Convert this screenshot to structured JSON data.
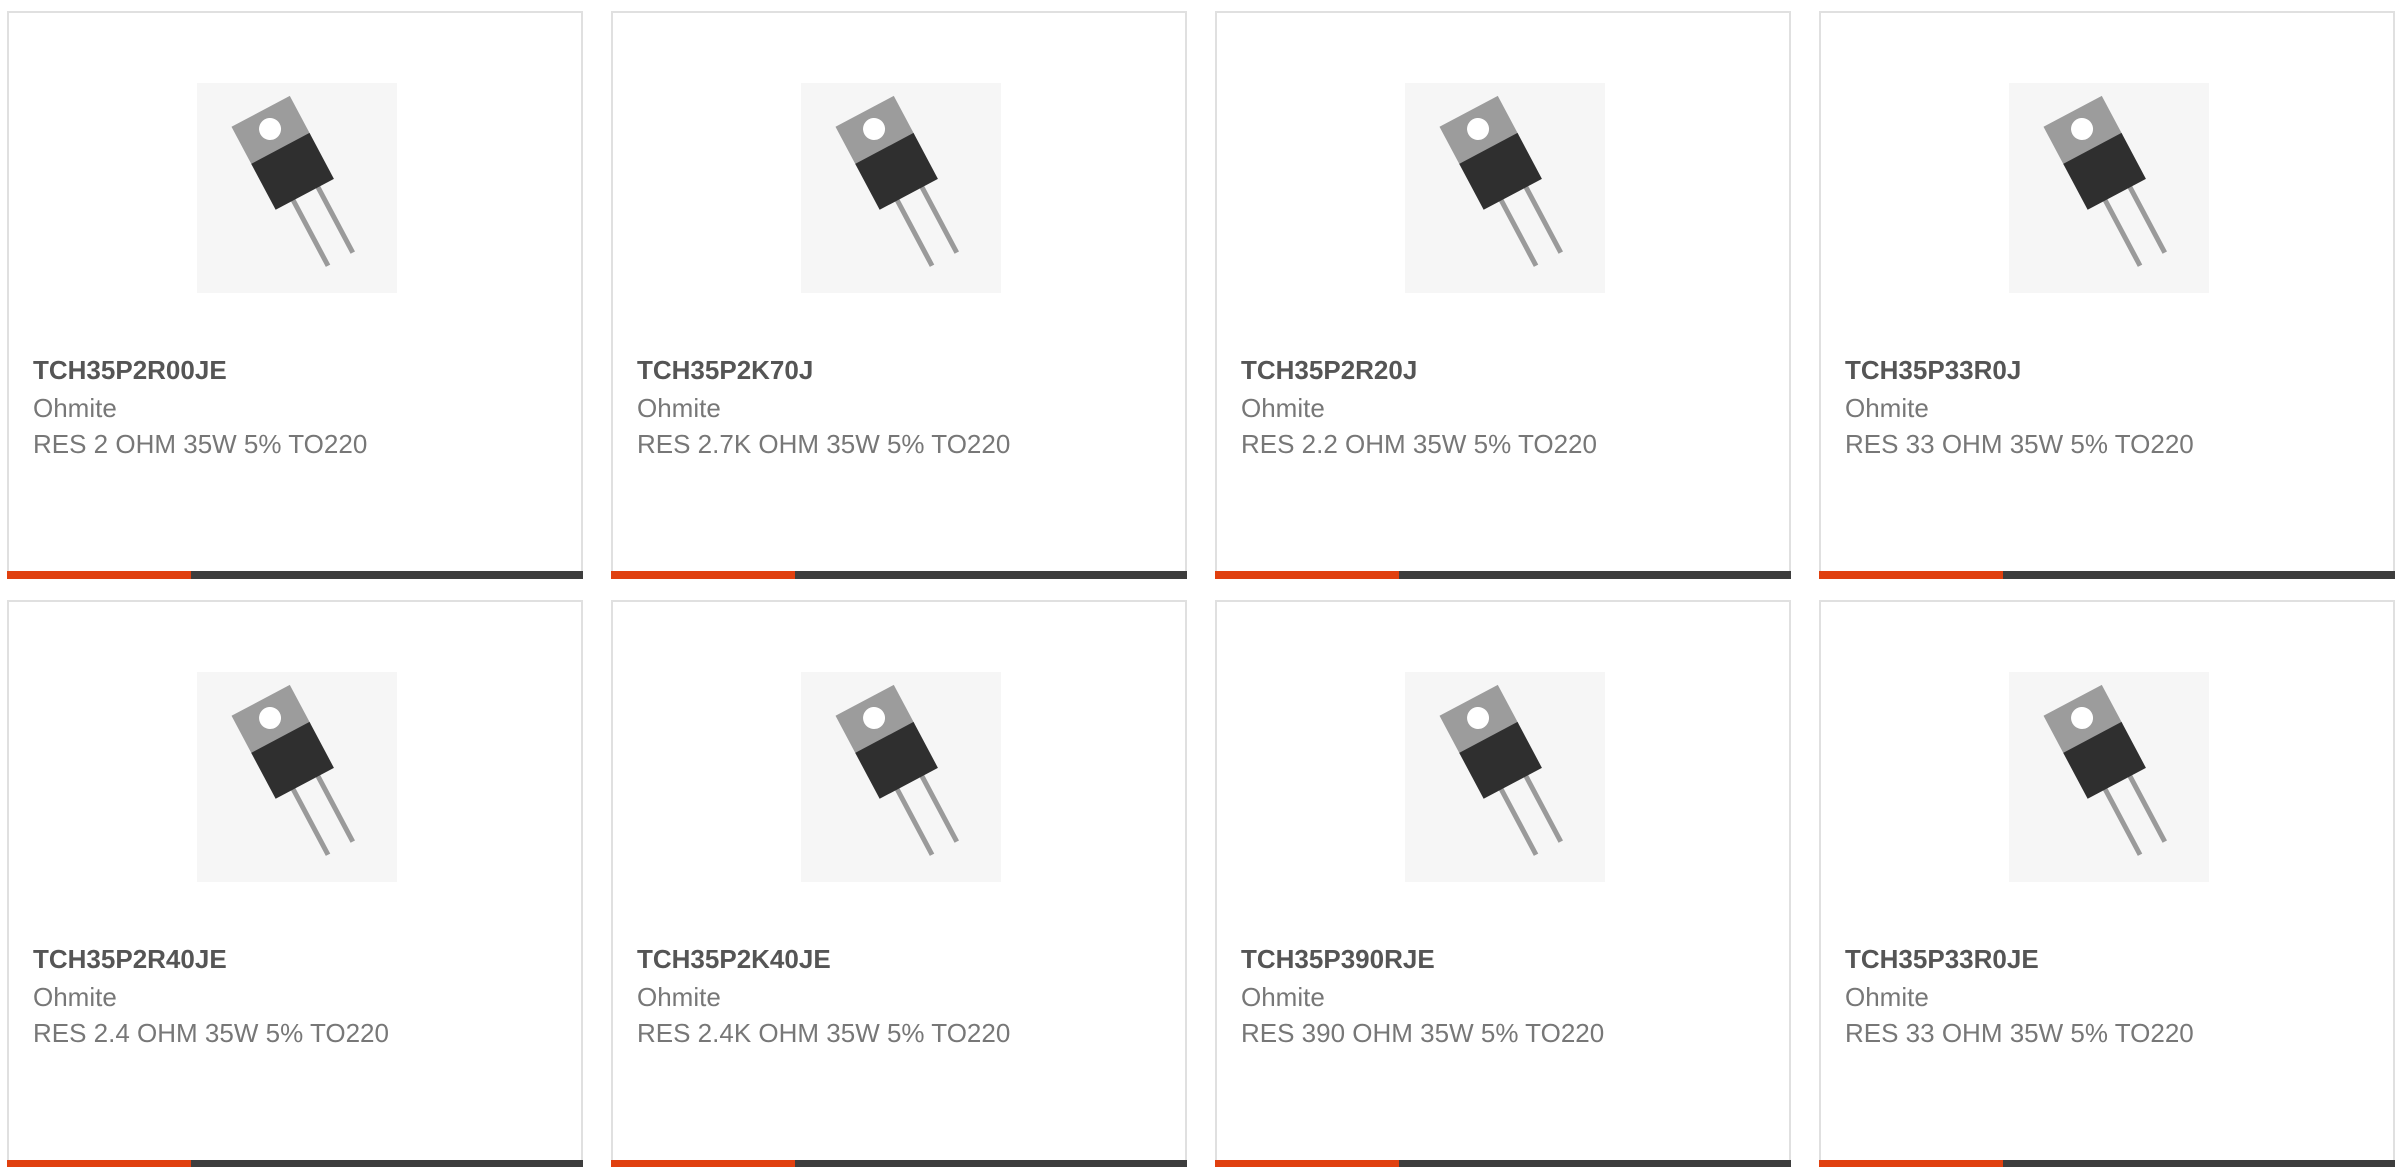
{
  "colors": {
    "accent": "#e0400f",
    "bar": "#3d3d3d",
    "border": "#e0e0e0",
    "part_text": "#555555",
    "meta_text": "#777777"
  },
  "products": [
    {
      "part": "TCH35P2R00JE",
      "manufacturer": "Ohmite",
      "description": "RES 2 OHM 35W 5% TO220",
      "icon": "to220-resistor-image"
    },
    {
      "part": "TCH35P2K70J",
      "manufacturer": "Ohmite",
      "description": "RES 2.7K OHM 35W 5% TO220",
      "icon": "to220-resistor-image"
    },
    {
      "part": "TCH35P2R20J",
      "manufacturer": "Ohmite",
      "description": "RES 2.2 OHM 35W 5% TO220",
      "icon": "to220-resistor-image"
    },
    {
      "part": "TCH35P33R0J",
      "manufacturer": "Ohmite",
      "description": "RES 33 OHM 35W 5% TO220",
      "icon": "to220-resistor-image"
    },
    {
      "part": "TCH35P2R40JE",
      "manufacturer": "Ohmite",
      "description": "RES 2.4 OHM 35W 5% TO220",
      "icon": "to220-resistor-image"
    },
    {
      "part": "TCH35P2K40JE",
      "manufacturer": "Ohmite",
      "description": "RES 2.4K OHM 35W 5% TO220",
      "icon": "to220-resistor-image"
    },
    {
      "part": "TCH35P390RJE",
      "manufacturer": "Ohmite",
      "description": "RES 390 OHM 35W 5% TO220",
      "icon": "to220-resistor-image"
    },
    {
      "part": "TCH35P33R0JE",
      "manufacturer": "Ohmite",
      "description": "RES 33 OHM 35W 5% TO220",
      "icon": "to220-resistor-image"
    }
  ]
}
